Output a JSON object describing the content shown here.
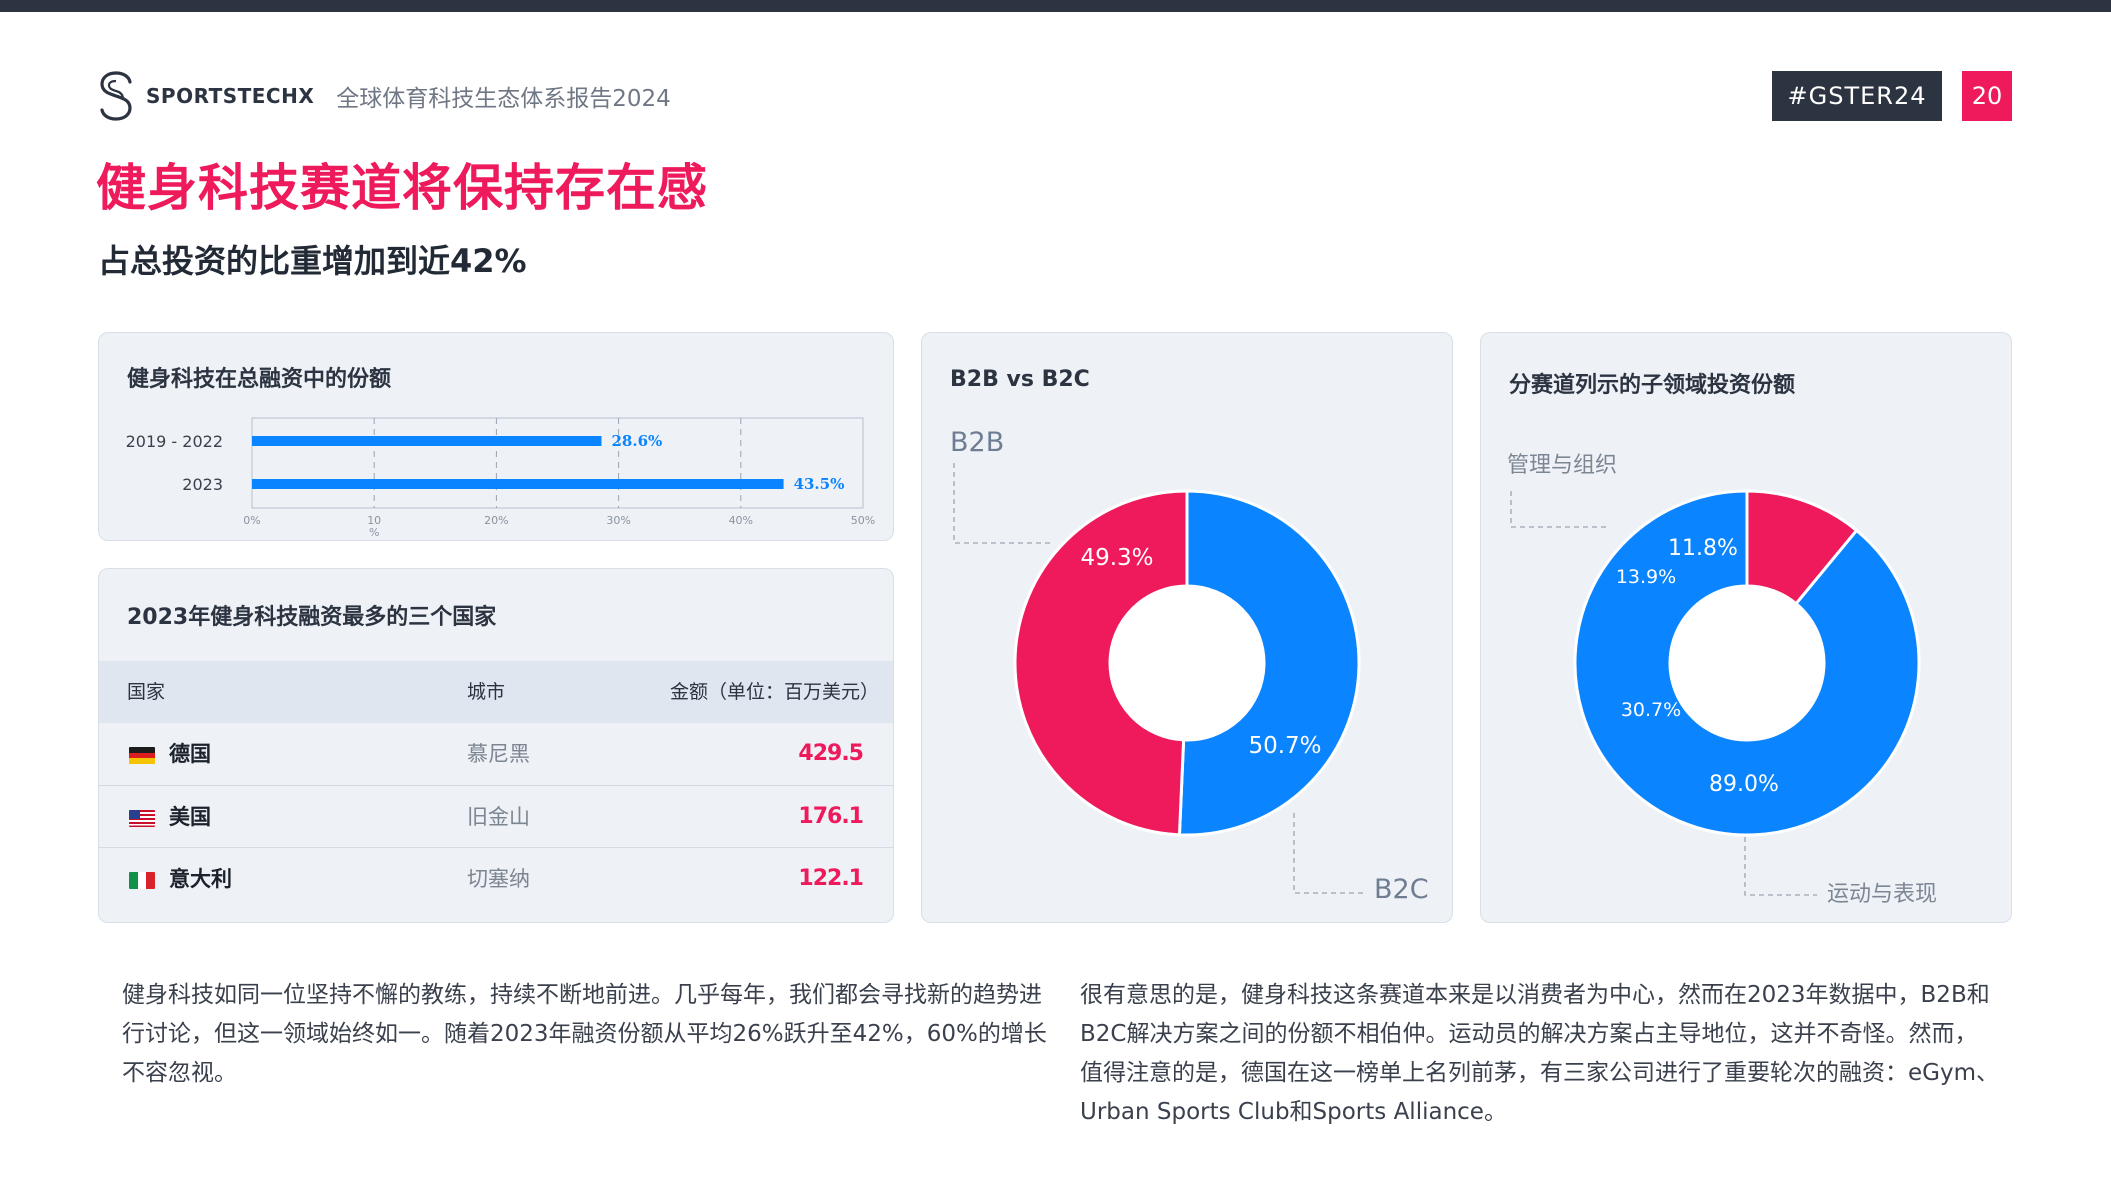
{
  "header": {
    "brand": "SPORTSTECHX",
    "report_title": "全球体育科技生态体系报告2024",
    "tag": "#GSTER24",
    "page_number": "20"
  },
  "headline": "健身科技赛道将保持存在感",
  "subheadline": "占总投资的比重增加到近42%",
  "colors": {
    "pink": "#ee1a5b",
    "blue": "#0a84ff",
    "dark": "#2c3442",
    "card_bg": "#eef2f7"
  },
  "bar_card": {
    "title": "健身科技在总融资中的份额",
    "chart_data": {
      "type": "bar",
      "orientation": "horizontal",
      "categories": [
        "2019 - 2022",
        "2023"
      ],
      "values": [
        28.6,
        43.5
      ],
      "value_labels": [
        "28.6%",
        "43.5%"
      ],
      "xlim": [
        0,
        50
      ],
      "x_ticks": [
        {
          "value": 0,
          "label": "0%"
        },
        {
          "value": 10,
          "label": "10"
        },
        {
          "value": 20,
          "label": "20%"
        },
        {
          "value": 30,
          "label": "30%"
        },
        {
          "value": 40,
          "label": "40%"
        },
        {
          "value": 50,
          "label": "50%"
        }
      ],
      "x_unit_label": "%",
      "grid": true,
      "series_color": "#0a84ff"
    }
  },
  "table_card": {
    "title": "2023年健身科技融资最多的三个国家",
    "headers": {
      "country": "国家",
      "city": "城市",
      "amount": "金额（单位：百万美元）"
    },
    "rows": [
      {
        "flag": "germany-flag-icon",
        "country": "德国",
        "city": "慕尼黑",
        "amount": "429.5"
      },
      {
        "flag": "usa-flag-icon",
        "country": "美国",
        "city": "旧金山",
        "amount": "176.1"
      },
      {
        "flag": "italy-flag-icon",
        "country": "意大利",
        "city": "切塞纳",
        "amount": "122.1"
      }
    ]
  },
  "b2b_card": {
    "title": "B2B vs B2C",
    "chart_data": {
      "type": "pie",
      "donut": true,
      "slices": [
        {
          "name": "B2C",
          "value": 50.7,
          "label": "50.7%",
          "color": "#0a84ff"
        },
        {
          "name": "B2B",
          "value": 49.3,
          "label": "49.3%",
          "color": "#ee1a5b"
        }
      ]
    }
  },
  "sub_card": {
    "title": "分赛道列示的子领域投资份额",
    "chart_data": {
      "type": "pie",
      "donut": true,
      "slices": [
        {
          "name": "运动与表现",
          "value": 89.0,
          "label": "89.0%",
          "color": "#0a84ff"
        },
        {
          "name": "管理与组织",
          "value": 11.0,
          "label": "11.8%",
          "color": "#ee1a5b"
        }
      ],
      "extra_labels": [
        {
          "text": "13.9%",
          "color": "#ffffff"
        },
        {
          "text": "30.7%",
          "color": "#ffffff"
        }
      ]
    }
  },
  "paragraphs": {
    "left": "健身科技如同一位坚持不懈的教练，持续不断地前进。几乎每年，我们都会寻找新的趋势进行讨论，但这一领域始终如一。随着2023年融资份额从平均26%跃升至42%，60%的增长不容忽视。",
    "right": "很有意思的是，健身科技这条赛道本来是以消费者为中心，然而在2023年数据中，B2B和B2C解决方案之间的份额不相伯仲。运动员的解决方案占主导地位，这并不奇怪。然而，值得注意的是，德国在这一榜单上名列前茅，有三家公司进行了重要轮次的融资：eGym、Urban Sports Club和Sports Alliance。"
  }
}
